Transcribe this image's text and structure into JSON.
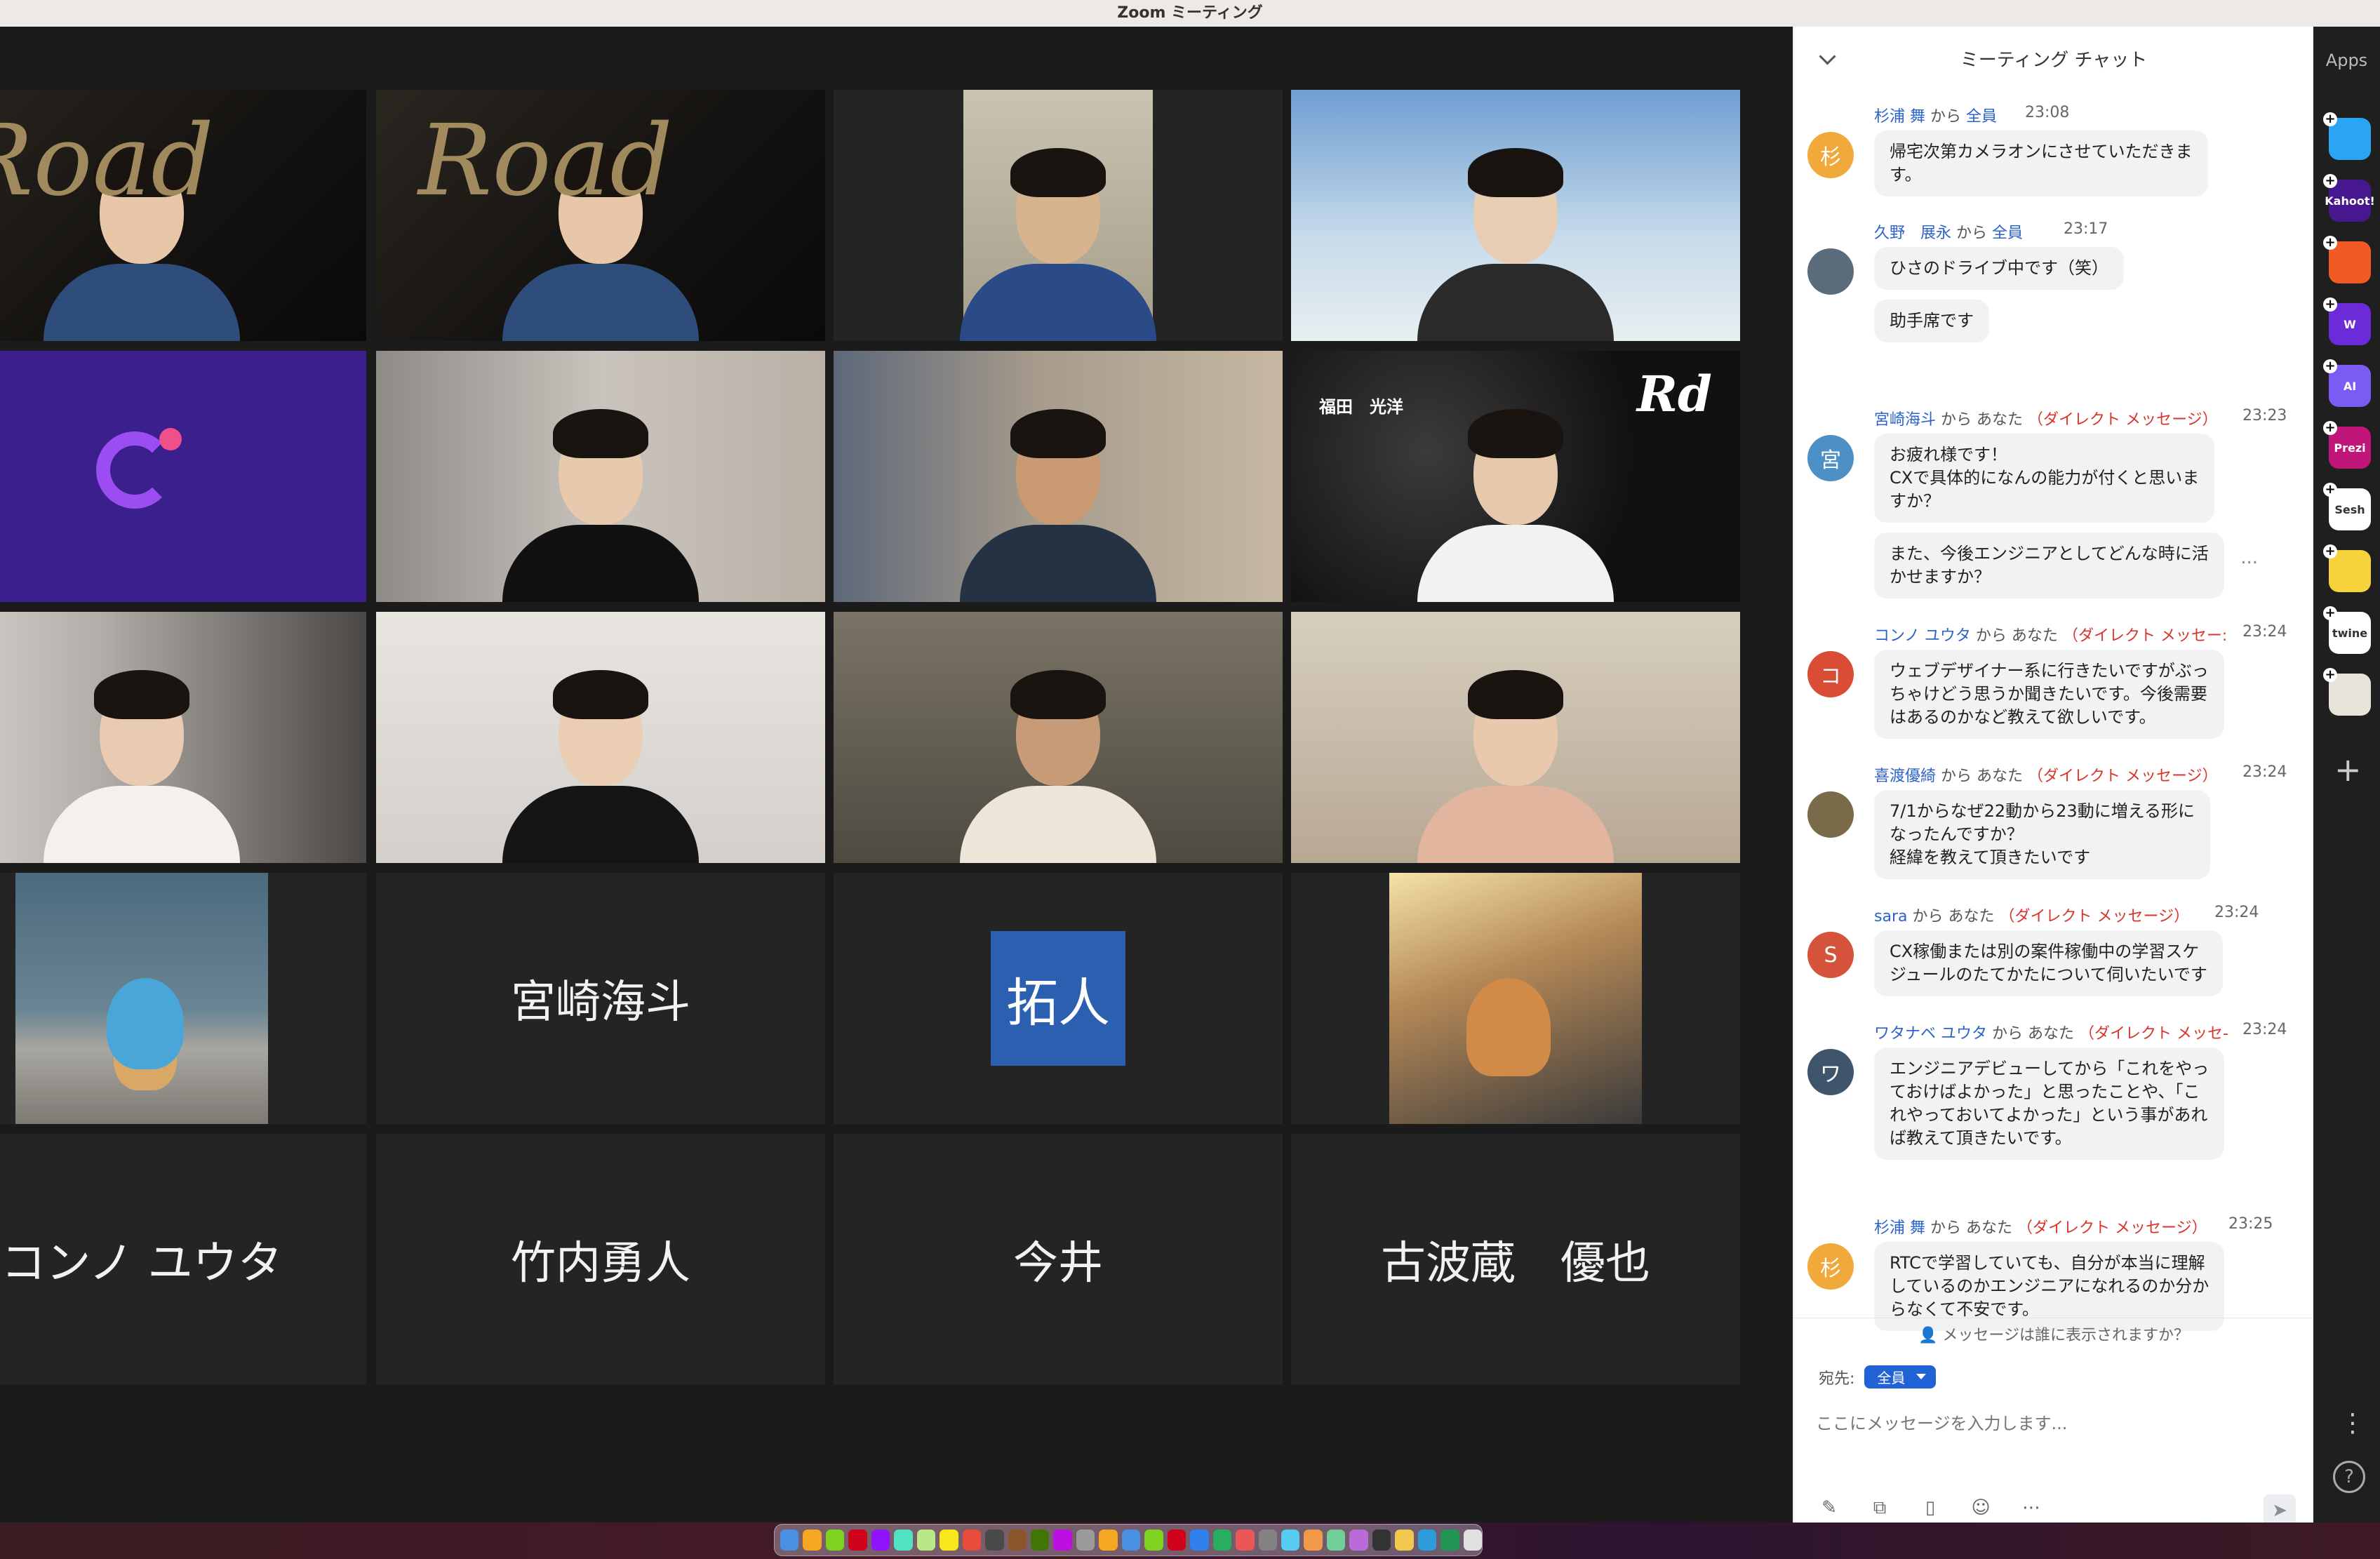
{
  "window": {
    "title": "Zoom ミーティング"
  },
  "gallery": {
    "tiles": [
      {
        "kind": "video",
        "bg": "road-logo",
        "overlay": "Road"
      },
      {
        "kind": "video",
        "bg": "road-logo",
        "overlay": "Road"
      },
      {
        "kind": "video",
        "bg": "office"
      },
      {
        "kind": "video",
        "bg": "sky"
      },
      {
        "kind": "app-logo"
      },
      {
        "kind": "video",
        "bg": "room"
      },
      {
        "kind": "video",
        "bg": "room-dark",
        "active": true
      },
      {
        "kind": "video",
        "bg": "virtual-bg",
        "overlay": "Rd",
        "badge": "福田　光洋"
      },
      {
        "kind": "video",
        "bg": "room-light"
      },
      {
        "kind": "video",
        "bg": "wall-plant"
      },
      {
        "kind": "video",
        "bg": "dim-room"
      },
      {
        "kind": "video",
        "bg": "room-beige"
      },
      {
        "kind": "photo",
        "bg": "plush-sea"
      },
      {
        "kind": "name",
        "name": "宮崎海斗"
      },
      {
        "kind": "avatar",
        "name": "拓人"
      },
      {
        "kind": "photo",
        "bg": "cat"
      },
      {
        "kind": "name",
        "name": "コンノ ユウタ"
      },
      {
        "kind": "name",
        "name": "竹内勇人"
      },
      {
        "kind": "name",
        "name": "今井"
      },
      {
        "kind": "name",
        "name": "古波蔵　優也"
      }
    ]
  },
  "chat": {
    "header": "ミーティング チャット",
    "messages": [
      {
        "avatar": "杉",
        "avatar_color": "#f0a93a",
        "sender": "杉浦 舞",
        "from": "から",
        "to": "全員",
        "dm": "",
        "time": "23:08",
        "bubbles": [
          "帰宅次第カメラオンにさせていただきま\nす。"
        ]
      },
      {
        "avatar": "",
        "avatar_color": "#5a6b7c",
        "sender": "久野　展永",
        "from": "から",
        "to": "全員",
        "dm": "",
        "time": "23:17",
        "bubbles": [
          "ひさのドライブ中です（笑）",
          "助手席です"
        ]
      },
      {
        "avatar": "宮",
        "avatar_color": "#4d90c6",
        "sender": "宮崎海斗",
        "from": "から",
        "to": "あなた",
        "dm": "（ダイレクト メッセージ）",
        "time": "23:23",
        "bubbles": [
          "お疲れ様です！\nCXで具体的になんの能力が付くと思いま\nすか？",
          "また、今後エンジニアとしてどんな時に活\nかせますか？"
        ]
      },
      {
        "avatar": "コ",
        "avatar_color": "#d94c36",
        "sender": "コンノ ユウタ",
        "from": "から",
        "to": "あなた",
        "dm": "（ダイレクト メッセー:",
        "time": "23:24",
        "bubbles": [
          "ウェブデザイナー系に行きたいですがぶっ\nちゃけどう思うか聞きたいです。今後需要\nはあるのかなど教えて欲しいです。"
        ]
      },
      {
        "avatar": "",
        "avatar_color": "#7b6a4a",
        "sender": "喜渡優綺",
        "from": "から",
        "to": "あなた",
        "dm": "（ダイレクト メッセージ）",
        "time": "23:24",
        "bubbles": [
          "7/1からなぜ22動から23動に増える形に\nなったんですか？\n経緯を教えて頂きたいです"
        ]
      },
      {
        "avatar": "S",
        "avatar_color": "#d5533b",
        "sender": "sara",
        "from": "から",
        "to": "あなた",
        "dm": "（ダイレクト メッセージ）",
        "time": "23:24",
        "bubbles": [
          "CX稼働または別の案件稼働中の学習スケ\nジュールのたてかたについて伺いたいです"
        ]
      },
      {
        "avatar": "ワ",
        "avatar_color": "#3f556b",
        "sender": "ワタナベ ユウタ",
        "from": "から",
        "to": "あなた",
        "dm": "（ダイレクト メッセ-",
        "time": "23:24",
        "bubbles": [
          "エンジニアデビューしてから「これをやっ\nておけばよかった」と思ったことや、「こ\nれやっておいてよかった」という事があれ\nば教えて頂きたいです。"
        ]
      },
      {
        "avatar": "杉",
        "avatar_color": "#f0a93a",
        "sender": "杉浦 舞",
        "from": "から",
        "to": "あなた",
        "dm": "（ダイレクト メッセージ）",
        "time": "23:25",
        "bubbles": [
          "RTCで学習していても、自分が本当に理解\nしているのかエンジニアになれるのか分か\nらなくて不安です。"
        ]
      }
    ],
    "more_options": "...",
    "who_sees": "メッセージは誰に表示されますか？",
    "recipient_label": "宛先:",
    "recipient_value": "全員",
    "input_placeholder": "ここにメッセージを入力します..."
  },
  "apps": {
    "title": "Apps",
    "items": [
      {
        "name": "app-icon-1",
        "label": "",
        "color": "#2aa4f4"
      },
      {
        "name": "kahoot",
        "label": "Kahoot!",
        "color": "#46178f"
      },
      {
        "name": "app-icon-3",
        "label": "",
        "color": "#f15a24"
      },
      {
        "name": "wooclap",
        "label": "W",
        "color": "#6c2bd9"
      },
      {
        "name": "ai-app",
        "label": "AI",
        "color": "#7a5cf5"
      },
      {
        "name": "prezi",
        "label": "Prezi",
        "color": "#c0167a"
      },
      {
        "name": "sesh",
        "label": "Sesh",
        "color": "#ffffff"
      },
      {
        "name": "emoji-app",
        "label": "",
        "color": "#f5d33b"
      },
      {
        "name": "twine",
        "label": "twine",
        "color": "#ffffff"
      },
      {
        "name": "grid-app",
        "label": "",
        "color": "#e8e3d8"
      }
    ]
  }
}
